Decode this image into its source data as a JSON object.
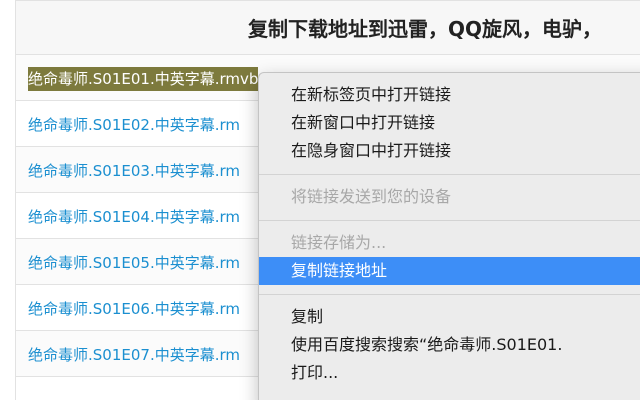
{
  "page": {
    "header": "复制下载地址到迅雷，QQ旋风，电驴，",
    "links": [
      {
        "label": "绝命毒师.S01E01.中英字幕.rmvb",
        "selected": true
      },
      {
        "label": "绝命毒师.S01E02.中英字幕.rm",
        "selected": false
      },
      {
        "label": "绝命毒师.S01E03.中英字幕.rm",
        "selected": false
      },
      {
        "label": "绝命毒师.S01E04.中英字幕.rm",
        "selected": false
      },
      {
        "label": "绝命毒师.S01E05.中英字幕.rm",
        "selected": false
      },
      {
        "label": "绝命毒师.S01E06.中英字幕.rm",
        "selected": false
      },
      {
        "label": "绝命毒师.S01E07.中英字幕.rm",
        "selected": false
      }
    ]
  },
  "context_menu": {
    "open_new_tab": "在新标签页中打开链接",
    "open_new_window": "在新窗口中打开链接",
    "open_incognito": "在隐身窗口中打开链接",
    "send_to_devices": "将链接发送到您的设备",
    "save_link_as": "链接存储为...",
    "copy_link_address": "复制链接地址",
    "copy": "复制",
    "search_baidu": "使用百度搜索搜索“绝命毒师.S01E01.",
    "print": "打印..."
  },
  "colors": {
    "link": "#1b8fd0",
    "selection_bg": "#7d7a3d",
    "menu_highlight": "#3d8ef7",
    "menu_bg": "#ececec"
  }
}
